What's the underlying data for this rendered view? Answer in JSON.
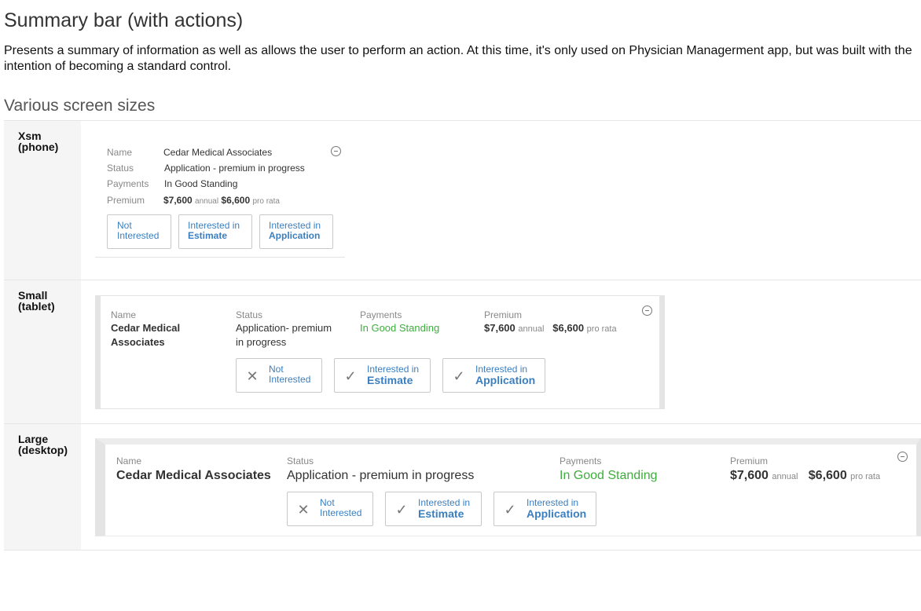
{
  "page": {
    "title": "Summary bar (with actions)",
    "description": "Presents a summary of information as well as allows the user to perform an action. At this time, it's only used on Physician Managerment app, but was built with the intention of becoming a standard control.",
    "section_title": "Various screen sizes"
  },
  "sizes": {
    "xsm": {
      "line1": "Xsm",
      "line2": "(phone)"
    },
    "small": {
      "line1": "Small",
      "line2": "(tablet)"
    },
    "large": {
      "line1": "Large",
      "line2": "(desktop)"
    }
  },
  "labels": {
    "name": "Name",
    "status": "Status",
    "payments": "Payments",
    "premium": "Premium"
  },
  "values": {
    "name": "Cedar Medical Associates",
    "name_line1": "Cedar Medical",
    "name_line2": "Associates",
    "status": "Application - premium in progress",
    "status_small_line1": "Application- premium",
    "status_small_line2": "in progress",
    "payments": "In Good Standing",
    "annual_amount": "$7,600",
    "annual_label": "annual",
    "prorata_amount": "$6,600",
    "prorata_label": "pro rata"
  },
  "actions": {
    "not_interested": {
      "line1": "Not",
      "line2": "Interested",
      "icon": "x-icon"
    },
    "estimate": {
      "line1": "Interested in",
      "line2": "Estimate",
      "icon": "check-icon"
    },
    "application": {
      "line1": "Interested in",
      "line2": "Application",
      "icon": "check-icon"
    }
  },
  "colors": {
    "link_blue": "#3b7fc0",
    "good_green": "#3cae3c"
  }
}
